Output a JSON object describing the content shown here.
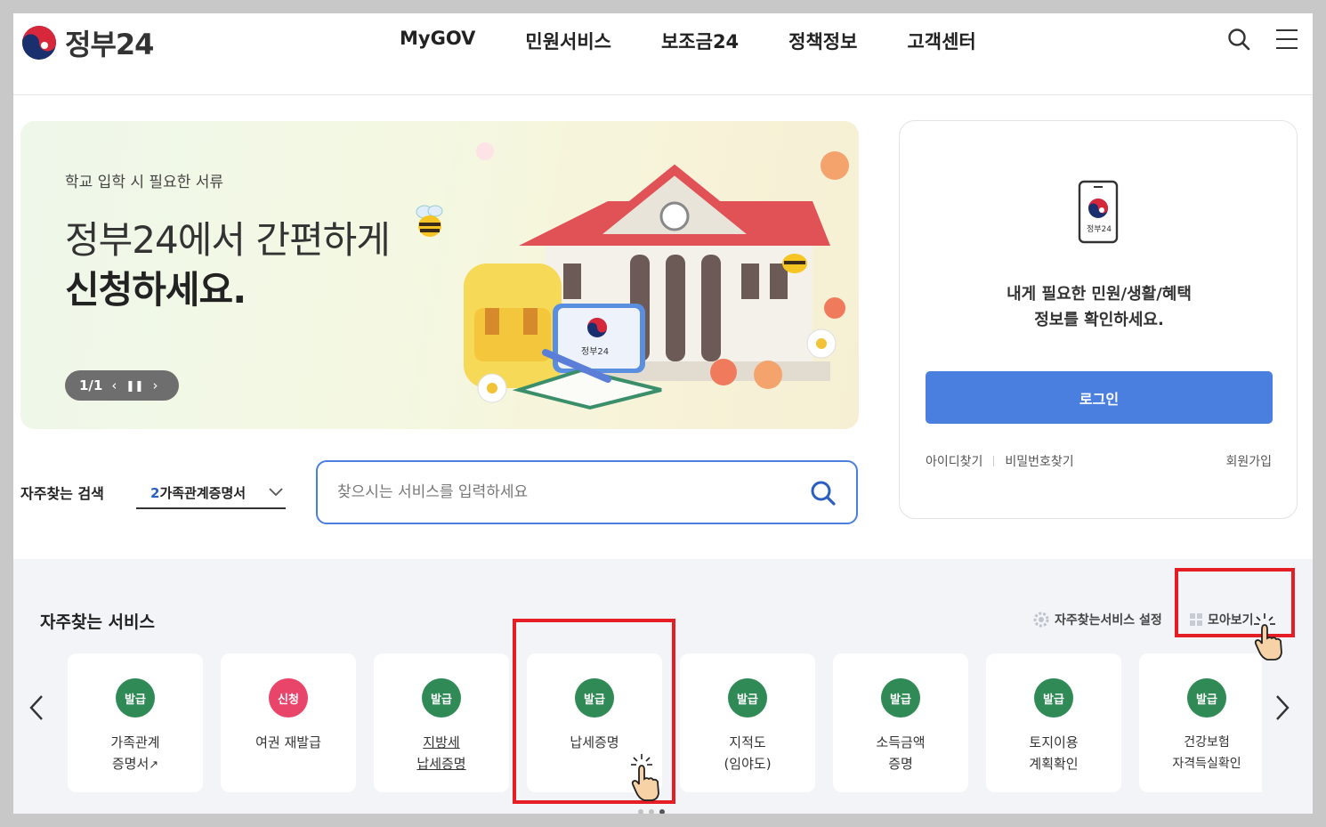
{
  "header": {
    "logo_text": "정부24",
    "nav": [
      "MyGOV",
      "민원서비스",
      "보조금24",
      "정책정보",
      "고객센터"
    ]
  },
  "banner": {
    "subtitle": "학교 입학 시 필요한 서류",
    "title_line1": "정부24에서 간편하게",
    "title_line2": "신청하세요.",
    "pager": "1/1",
    "illustration_text": "정부24"
  },
  "login": {
    "phone_icon_text": "정부24",
    "message_line1": "내게 필요한 민원/생활/혜택",
    "message_line2": "정보를 확인하세요.",
    "button": "로그인",
    "find_id": "아이디찾기",
    "find_pw": "비밀번호찾기",
    "join": "회원가입"
  },
  "search": {
    "label": "자주찾는 검색",
    "select_num": "2",
    "select_text": "가족관계증명서",
    "placeholder": "찾으시는 서비스를 입력하세요"
  },
  "favorites": {
    "title": "자주찾는 서비스",
    "setting": "자주찾는서비스 설정",
    "view_all": "모아보기",
    "cards": [
      {
        "badge": "발급",
        "line1": "가족관계",
        "line2": "증명서"
      },
      {
        "badge": "신청",
        "line1": "여권 재발급",
        "line2": ""
      },
      {
        "badge": "발급",
        "line1": "지방세",
        "line2": "납세증명"
      },
      {
        "badge": "발급",
        "line1": "납세증명",
        "line2": ""
      },
      {
        "badge": "발급",
        "line1": "지적도",
        "line2": "(임야도)"
      },
      {
        "badge": "발급",
        "line1": "소득금액",
        "line2": "증명"
      },
      {
        "badge": "발급",
        "line1": "토지이용",
        "line2": "계획확인"
      },
      {
        "badge": "발급",
        "line1": "건강보험",
        "line2": "자격득실확인"
      }
    ]
  },
  "colors": {
    "primary_blue": "#4a7fe0",
    "badge_green": "#2f8a55",
    "badge_pink": "#e9456b",
    "highlight_red": "#e51d24"
  }
}
